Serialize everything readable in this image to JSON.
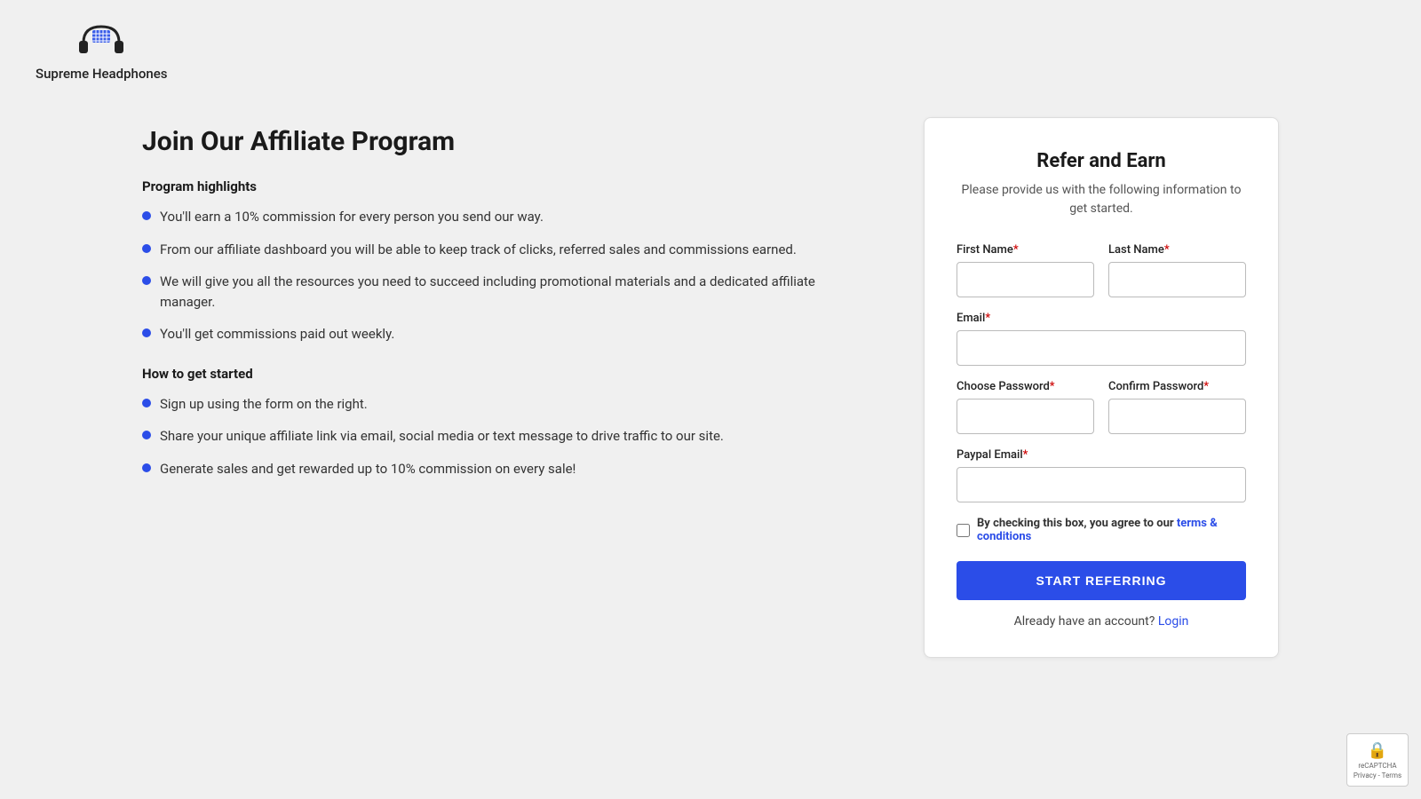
{
  "brand": {
    "name": "Supreme Headphones"
  },
  "header": {
    "title": "Join Our Affiliate Program"
  },
  "left": {
    "highlights_heading": "Program highlights",
    "highlights": [
      "You'll earn a 10% commission for every person you send our way.",
      "From our affiliate dashboard you will be able to keep track of clicks, referred sales and commissions earned.",
      "We will give you all the resources you need to succeed including promotional materials and a dedicated affiliate manager.",
      "You'll get commissions paid out weekly."
    ],
    "how_heading": "How to get started",
    "how_items": [
      "Sign up using the form on the right.",
      "Share your unique affiliate link via email, social media or text message to drive traffic to our site.",
      "Generate sales and get rewarded up to 10% commission on every sale!"
    ]
  },
  "form": {
    "title": "Refer and Earn",
    "subtitle": "Please provide us with the following information to get started.",
    "first_name_label": "First Name",
    "last_name_label": "Last Name",
    "email_label": "Email",
    "password_label": "Choose Password",
    "confirm_password_label": "Confirm Password",
    "paypal_email_label": "Paypal Email",
    "terms_text": "By checking this box, you agree to our ",
    "terms_link": "terms & conditions",
    "submit_label": "START REFERRING",
    "login_text": "Already have an account?",
    "login_link": "Login"
  },
  "recaptcha": {
    "label": "reCAPTCHA",
    "privacy": "Privacy - Terms"
  }
}
